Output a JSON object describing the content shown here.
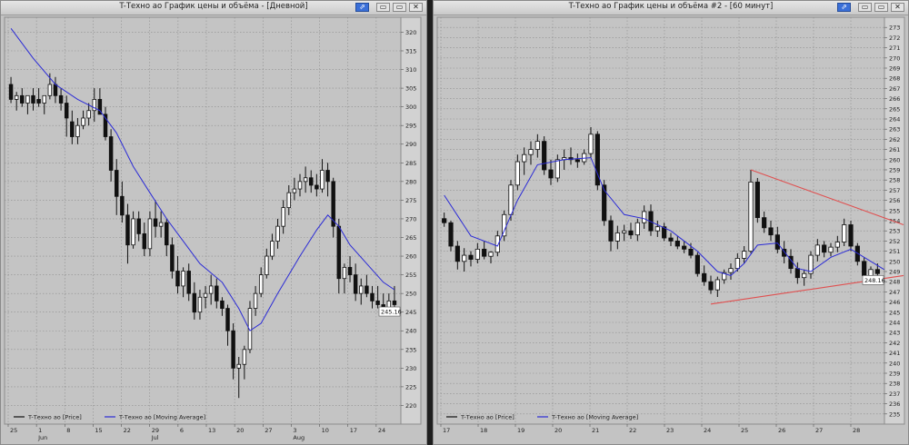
{
  "windows": [
    {
      "title": "T-Техно ао График цены и объёма - [Дневной]",
      "buttons": {
        "pin": "⇗",
        "min": "▭",
        "max": "▭",
        "close": "✕"
      },
      "chart_data": {
        "type": "candlestick",
        "ylim": [
          215,
          324
        ],
        "y_ticks": [
          220,
          225,
          230,
          235,
          240,
          245,
          250,
          255,
          260,
          265,
          270,
          275,
          280,
          285,
          290,
          295,
          300,
          305,
          310,
          315,
          320
        ],
        "x_tick_labels": [
          "25",
          "1",
          "8",
          "15",
          "22",
          "29",
          "6",
          "13",
          "20",
          "27",
          "3",
          "10",
          "17",
          "24"
        ],
        "x_month_labels": [
          {
            "at": 1,
            "label": "Jun"
          },
          {
            "at": 5,
            "label": "Jul"
          },
          {
            "at": 10,
            "label": "Aug"
          }
        ],
        "last_price": "245.16",
        "legend": [
          {
            "label": "T-Техно ао [Price]",
            "color": "#111111"
          },
          {
            "label": "T-Техно ао [Moving Average]",
            "color": "#2b2bd6"
          }
        ],
        "ohlc": [
          [
            306,
            308,
            301,
            302
          ],
          [
            302,
            304,
            299,
            303
          ],
          [
            303,
            305,
            300,
            301
          ],
          [
            301,
            303,
            298,
            303
          ],
          [
            303,
            305,
            299,
            301
          ],
          [
            302,
            305,
            300,
            301
          ],
          [
            301,
            303,
            298,
            303
          ],
          [
            303,
            309,
            302,
            306
          ],
          [
            306,
            308,
            301,
            303
          ],
          [
            303,
            305,
            299,
            301
          ],
          [
            301,
            303,
            292,
            297
          ],
          [
            296,
            299,
            290,
            292
          ],
          [
            292,
            297,
            290,
            295
          ],
          [
            295,
            299,
            294,
            297
          ],
          [
            297,
            301,
            295,
            299
          ],
          [
            299,
            305,
            296,
            302
          ],
          [
            302,
            305,
            298,
            298
          ],
          [
            298,
            300,
            291,
            292
          ],
          [
            292,
            294,
            280,
            283
          ],
          [
            283,
            286,
            271,
            276
          ],
          [
            276,
            280,
            269,
            271
          ],
          [
            271,
            274,
            258,
            263
          ],
          [
            263,
            272,
            262,
            270
          ],
          [
            270,
            272,
            264,
            266
          ],
          [
            266,
            269,
            260,
            262
          ],
          [
            262,
            272,
            260,
            270
          ],
          [
            270,
            275,
            265,
            268
          ],
          [
            268,
            272,
            265,
            269
          ],
          [
            269,
            270,
            260,
            263
          ],
          [
            263,
            265,
            254,
            256
          ],
          [
            256,
            260,
            250,
            252
          ],
          [
            252,
            257,
            249,
            256
          ],
          [
            256,
            258,
            248,
            250
          ],
          [
            250,
            253,
            243,
            245
          ],
          [
            245,
            251,
            243,
            249
          ],
          [
            249,
            252,
            246,
            250
          ],
          [
            250,
            255,
            247,
            252
          ],
          [
            252,
            254,
            246,
            248
          ],
          [
            248,
            249,
            244,
            246
          ],
          [
            246,
            247,
            236,
            240
          ],
          [
            240,
            242,
            227,
            230
          ],
          [
            230,
            233,
            222,
            231
          ],
          [
            231,
            236,
            227,
            235
          ],
          [
            235,
            248,
            234,
            246
          ],
          [
            246,
            252,
            244,
            250
          ],
          [
            250,
            257,
            249,
            255
          ],
          [
            255,
            262,
            254,
            260
          ],
          [
            260,
            266,
            259,
            264
          ],
          [
            264,
            270,
            262,
            268
          ],
          [
            268,
            275,
            266,
            273
          ],
          [
            273,
            279,
            271,
            277
          ],
          [
            277,
            281,
            275,
            278
          ],
          [
            278,
            282,
            276,
            280
          ],
          [
            280,
            284,
            277,
            281
          ],
          [
            281,
            283,
            277,
            279
          ],
          [
            279,
            282,
            276,
            278
          ],
          [
            278,
            286,
            277,
            283
          ],
          [
            283,
            285,
            276,
            280
          ],
          [
            280,
            281,
            265,
            268
          ],
          [
            268,
            270,
            250,
            254
          ],
          [
            254,
            258,
            250,
            257
          ],
          [
            257,
            260,
            253,
            255
          ],
          [
            255,
            258,
            248,
            250
          ],
          [
            250,
            254,
            247,
            252
          ],
          [
            252,
            255,
            249,
            250
          ],
          [
            250,
            252,
            246,
            248
          ],
          [
            248,
            252,
            246,
            247
          ],
          [
            247,
            250,
            245,
            246
          ],
          [
            246,
            250,
            244,
            248
          ],
          [
            248,
            252,
            245,
            247
          ]
        ],
        "moving_average": [
          [
            0,
            321
          ],
          [
            4,
            313
          ],
          [
            8,
            306
          ],
          [
            12,
            302
          ],
          [
            16,
            299
          ],
          [
            19,
            293
          ],
          [
            22,
            284
          ],
          [
            25,
            277
          ],
          [
            28,
            270
          ],
          [
            31,
            264
          ],
          [
            34,
            258
          ],
          [
            38,
            253
          ],
          [
            41,
            246
          ],
          [
            43,
            240
          ],
          [
            45,
            242
          ],
          [
            48,
            250
          ],
          [
            52,
            260
          ],
          [
            55,
            267
          ],
          [
            57,
            271
          ],
          [
            59,
            268
          ],
          [
            61,
            263
          ],
          [
            64,
            258
          ],
          [
            67,
            253
          ],
          [
            69,
            251
          ]
        ]
      }
    },
    {
      "title": "T-Техно ао График цены и объёма #2 - [60 минут]",
      "buttons": {
        "pin": "⇗",
        "min": "▭",
        "max": "▭",
        "close": "✕"
      },
      "chart_data": {
        "type": "candlestick",
        "ylim": [
          234,
          274
        ],
        "y_ticks": [
          235,
          236,
          237,
          238,
          239,
          240,
          241,
          242,
          243,
          244,
          245,
          246,
          247,
          248,
          249,
          250,
          251,
          252,
          253,
          254,
          255,
          256,
          257,
          258,
          259,
          260,
          261,
          262,
          263,
          264,
          265,
          266,
          267,
          268,
          269,
          270,
          271,
          272,
          273
        ],
        "x_tick_labels": [
          "17",
          "18",
          "19",
          "20",
          "21",
          "22",
          "23",
          "24",
          "25",
          "26",
          "27",
          "28"
        ],
        "last_price": "248.16",
        "legend": [
          {
            "label": "T-Техно ао [Price]",
            "color": "#111111"
          },
          {
            "label": "T-Техно ао [Moving Average]",
            "color": "#2b2bd6"
          }
        ],
        "ohlc": [
          [
            254.2,
            254.8,
            253.4,
            253.8
          ],
          [
            253.8,
            254.0,
            251.0,
            251.5
          ],
          [
            251.5,
            252.0,
            249.2,
            250.0
          ],
          [
            250.0,
            251.3,
            249.0,
            250.6
          ],
          [
            250.6,
            251.0,
            249.5,
            250.2
          ],
          [
            250.2,
            251.8,
            249.8,
            251.2
          ],
          [
            251.2,
            252.0,
            250.2,
            250.5
          ],
          [
            250.5,
            251.0,
            249.8,
            250.9
          ],
          [
            250.9,
            253.0,
            250.5,
            252.5
          ],
          [
            252.5,
            255.0,
            252.0,
            254.6
          ],
          [
            254.6,
            258.0,
            254.0,
            257.5
          ],
          [
            257.5,
            260.5,
            257.0,
            259.8
          ],
          [
            259.8,
            261.2,
            258.5,
            260.5
          ],
          [
            260.5,
            261.8,
            259.5,
            261.0
          ],
          [
            261.0,
            262.5,
            260.2,
            261.8
          ],
          [
            261.8,
            262.3,
            258.5,
            259.0
          ],
          [
            259.0,
            260.0,
            257.5,
            258.2
          ],
          [
            258.2,
            260.5,
            257.8,
            260.0
          ],
          [
            260.0,
            261.0,
            259.0,
            260.2
          ],
          [
            260.2,
            261.2,
            259.5,
            260.0
          ],
          [
            260.0,
            260.6,
            259.2,
            259.8
          ],
          [
            259.8,
            261.0,
            259.5,
            260.6
          ],
          [
            260.6,
            263.2,
            260.2,
            262.5
          ],
          [
            262.5,
            262.8,
            257.0,
            257.5
          ],
          [
            257.5,
            258.0,
            253.5,
            254.0
          ],
          [
            254.0,
            254.5,
            251.0,
            252.0
          ],
          [
            252.0,
            253.5,
            251.2,
            252.8
          ],
          [
            252.8,
            253.6,
            252.0,
            253.0
          ],
          [
            253.0,
            253.8,
            252.2,
            252.6
          ],
          [
            252.6,
            254.2,
            252.0,
            253.8
          ],
          [
            253.8,
            255.5,
            253.2,
            254.9
          ],
          [
            254.9,
            255.6,
            252.5,
            253.0
          ],
          [
            253.0,
            254.0,
            252.4,
            253.4
          ],
          [
            253.4,
            253.8,
            252.0,
            252.3
          ],
          [
            252.3,
            252.8,
            251.5,
            252.0
          ],
          [
            252.0,
            252.5,
            251.2,
            251.5
          ],
          [
            251.5,
            252.0,
            250.8,
            251.2
          ],
          [
            251.2,
            251.8,
            250.3,
            250.6
          ],
          [
            250.6,
            250.9,
            248.5,
            248.8
          ],
          [
            248.8,
            249.6,
            247.6,
            248.0
          ],
          [
            248.0,
            248.6,
            246.8,
            247.2
          ],
          [
            247.2,
            248.5,
            246.5,
            248.2
          ],
          [
            248.2,
            249.2,
            247.8,
            248.9
          ],
          [
            248.9,
            249.8,
            248.2,
            249.3
          ],
          [
            249.3,
            250.8,
            249.0,
            250.3
          ],
          [
            250.3,
            251.5,
            249.8,
            251.0
          ],
          [
            251.0,
            259.0,
            250.8,
            257.8
          ],
          [
            257.8,
            258.2,
            253.8,
            254.3
          ],
          [
            254.3,
            254.9,
            252.8,
            253.3
          ],
          [
            253.3,
            254.0,
            252.0,
            252.6
          ],
          [
            252.6,
            253.4,
            250.8,
            251.2
          ],
          [
            251.2,
            252.0,
            249.8,
            250.5
          ],
          [
            250.5,
            251.2,
            248.8,
            249.3
          ],
          [
            249.3,
            249.9,
            247.8,
            248.4
          ],
          [
            248.4,
            249.2,
            247.6,
            248.8
          ],
          [
            248.8,
            251.0,
            248.3,
            250.6
          ],
          [
            250.6,
            252.2,
            250.0,
            251.6
          ],
          [
            251.6,
            252.0,
            250.4,
            250.9
          ],
          [
            250.9,
            251.8,
            250.5,
            251.4
          ],
          [
            251.4,
            252.5,
            250.9,
            251.9
          ],
          [
            251.9,
            254.2,
            251.5,
            253.6
          ],
          [
            253.6,
            254.0,
            251.0,
            251.5
          ],
          [
            251.5,
            251.8,
            249.6,
            250.0
          ],
          [
            250.0,
            250.4,
            248.4,
            248.6
          ],
          [
            248.6,
            249.5,
            248.0,
            249.2
          ],
          [
            249.2,
            249.8,
            248.5,
            248.8
          ]
        ],
        "moving_average": [
          [
            0,
            256.5
          ],
          [
            4,
            252.5
          ],
          [
            8,
            251.5
          ],
          [
            11,
            256.0
          ],
          [
            14,
            259.5
          ],
          [
            18,
            260.0
          ],
          [
            22,
            260.2
          ],
          [
            24,
            257.0
          ],
          [
            27,
            254.6
          ],
          [
            30,
            254.2
          ],
          [
            34,
            253.0
          ],
          [
            38,
            251.0
          ],
          [
            41,
            249.0
          ],
          [
            43,
            248.6
          ],
          [
            45,
            249.8
          ],
          [
            47,
            251.6
          ],
          [
            50,
            251.8
          ],
          [
            53,
            249.3
          ],
          [
            55,
            249.0
          ],
          [
            58,
            250.4
          ],
          [
            61,
            251.2
          ],
          [
            64,
            250.0
          ],
          [
            66,
            249.2
          ]
        ],
        "trendlines": [
          {
            "from": [
              46,
              259.0
            ],
            "to": [
              67,
              253.6
            ],
            "color": "#e05050"
          },
          {
            "from": [
              40,
              245.8
            ],
            "to": [
              67,
              248.6
            ],
            "color": "#e05050"
          }
        ]
      }
    }
  ]
}
